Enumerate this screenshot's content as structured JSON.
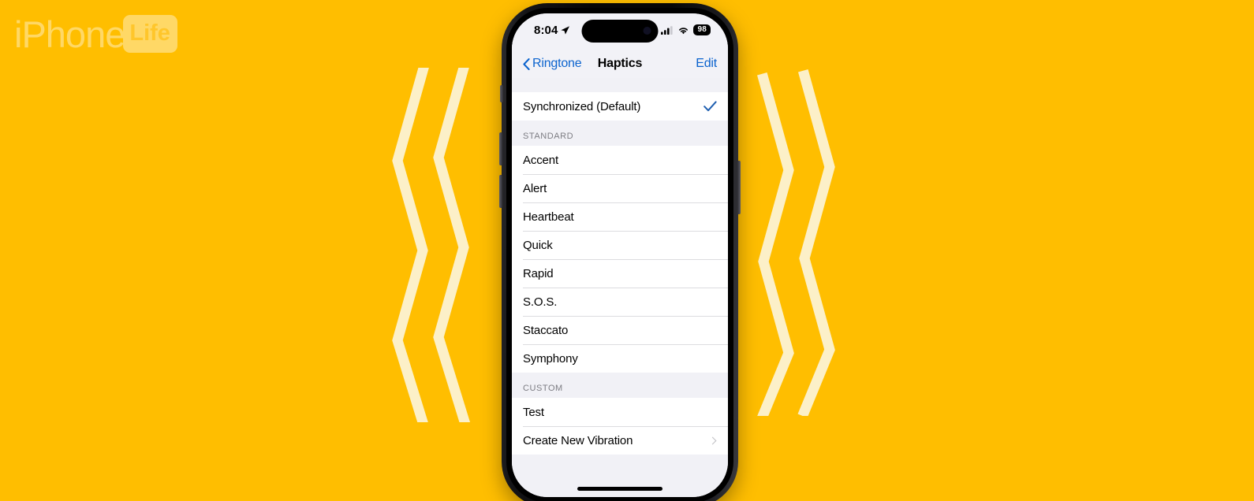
{
  "page": {
    "background_color": "#FFBE00",
    "accent_color": "#0B63CE",
    "zigzag_color": "#FCF0C8"
  },
  "brand": {
    "word": "iPhone",
    "badge": "Life",
    "logo_color": "#FFD866"
  },
  "decor": {
    "zigzag_left_name": "zigzag-decoration-left",
    "zigzag_right_name": "zigzag-decoration-right"
  },
  "phone": {
    "status_bar": {
      "time": "8:04",
      "location_icon": "location-arrow-icon",
      "cellular_icon": "cellular-signal-icon",
      "wifi_icon": "wifi-icon",
      "battery_level": "98"
    },
    "nav": {
      "back_label": "Ringtone",
      "back_icon": "chevron-left-icon",
      "title": "Haptics",
      "edit_label": "Edit"
    },
    "selected_group": {
      "rows": [
        {
          "label": "Synchronized (Default)",
          "accessory": "checkmark",
          "selected": true
        }
      ]
    },
    "sections": [
      {
        "header": "STANDARD",
        "rows": [
          {
            "label": "Accent",
            "accessory": "none"
          },
          {
            "label": "Alert",
            "accessory": "none"
          },
          {
            "label": "Heartbeat",
            "accessory": "none"
          },
          {
            "label": "Quick",
            "accessory": "none"
          },
          {
            "label": "Rapid",
            "accessory": "none"
          },
          {
            "label": "S.O.S.",
            "accessory": "none"
          },
          {
            "label": "Staccato",
            "accessory": "none"
          },
          {
            "label": "Symphony",
            "accessory": "none"
          }
        ]
      },
      {
        "header": "CUSTOM",
        "rows": [
          {
            "label": "Test",
            "accessory": "none"
          },
          {
            "label": "Create New Vibration",
            "accessory": "chevron"
          }
        ]
      }
    ],
    "hardware": {
      "silence_switch": "silence-switch",
      "volume_up": "volume-up-button",
      "volume_down": "volume-down-button",
      "power": "power-button",
      "home_indicator": "home-indicator"
    }
  }
}
